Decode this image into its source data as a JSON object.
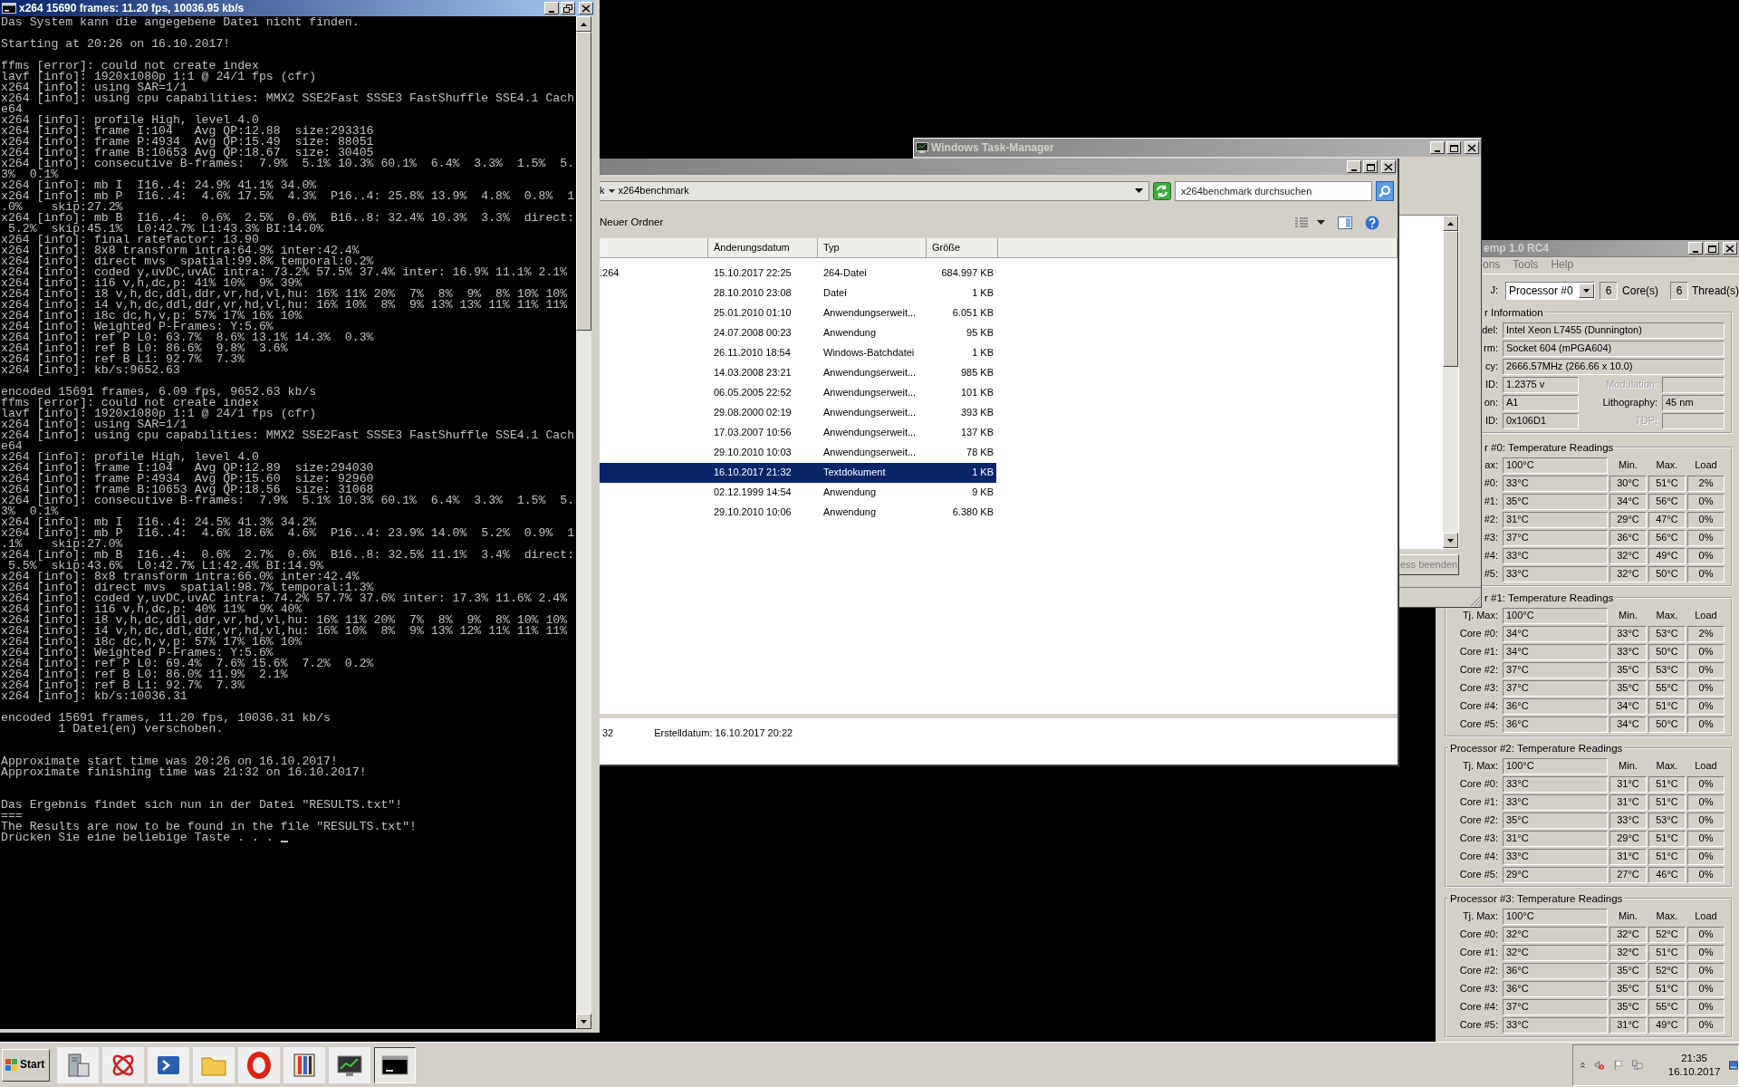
{
  "console": {
    "title": "x264 15690 frames: 11.20 fps, 10036.95 kb/s",
    "cursor_visible": true,
    "sections": [
      {
        "blocks": [
          [
            "Das System kann die angegebene Datei nicht finden."
          ],
          [
            "Starting at 20:26 on 16.10.2017!"
          ],
          [
            "ffms [error]: could not create index",
            "lavf [info]: 1920x1080p 1:1 @ 24/1 fps (cfr)",
            "x264 [info]: using SAR=1/1",
            "x264 [info]: using cpu capabilities: MMX2 SSE2Fast SSSE3 FastShuffle SSE4.1 Cach",
            "e64",
            "x264 [info]: profile High, level 4.0",
            "x264 [info]: frame I:104   Avg QP:12.88  size:293316",
            "x264 [info]: frame P:4934  Avg QP:15.49  size: 88051",
            "x264 [info]: frame B:10653 Avg QP:18.67  size: 30405",
            "x264 [info]: consecutive B-frames:  7.9%  5.1% 10.3% 60.1%  6.4%  3.3%  1.5%  5.",
            "3%  0.1%",
            "x264 [info]: mb I  I16..4: 24.9% 41.1% 34.0%",
            "x264 [info]: mb P  I16..4:  4.6% 17.5%  4.3%  P16..4: 25.8% 13.9%  4.8%  0.8%  1",
            ".0%    skip:27.2%",
            "x264 [info]: mb B  I16..4:  0.6%  2.5%  0.6%  B16..8: 32.4% 10.3%  3.3%  direct:",
            " 5.2%  skip:45.1%  L0:42.7% L1:43.3% BI:14.0%",
            "x264 [info]: final ratefactor: 13.90",
            "x264 [info]: 8x8 transform intra:64.9% inter:42.4%",
            "x264 [info]: direct mvs  spatial:99.8% temporal:0.2%",
            "x264 [info]: coded y,uvDC,uvAC intra: 73.2% 57.5% 37.4% inter: 16.9% 11.1% 2.1%",
            "x264 [info]: i16 v,h,dc,p: 41% 10%  9% 39%",
            "x264 [info]: i8 v,h,dc,ddl,ddr,vr,hd,vl,hu: 16% 11% 20%  7%  8%  9%  8% 10% 10%",
            "x264 [info]: i4 v,h,dc,ddl,ddr,vr,hd,vl,hu: 16% 10%  8%  9% 13% 13% 11% 11% 11%",
            "x264 [info]: i8c dc,h,v,p: 57% 17% 16% 10%",
            "x264 [info]: Weighted P-Frames: Y:5.6%",
            "x264 [info]: ref P L0: 63.7%  8.6% 13.1% 14.3%  0.3%",
            "x264 [info]: ref B L0: 86.6%  9.8%  3.6%",
            "x264 [info]: ref B L1: 92.7%  7.3%",
            "x264 [info]: kb/s:9652.63"
          ],
          [
            "encoded 15691 frames, 6.09 fps, 9652.63 kb/s",
            "ffms [error]: could not create index",
            "lavf [info]: 1920x1080p 1:1 @ 24/1 fps (cfr)",
            "x264 [info]: using SAR=1/1",
            "x264 [info]: using cpu capabilities: MMX2 SSE2Fast SSSE3 FastShuffle SSE4.1 Cach",
            "e64",
            "x264 [info]: profile High, level 4.0",
            "x264 [info]: frame I:104   Avg QP:12.89  size:294030",
            "x264 [info]: frame P:4934  Avg QP:15.60  size: 92960",
            "x264 [info]: frame B:10653 Avg QP:18.56  size: 31068",
            "x264 [info]: consecutive B-frames:  7.9%  5.1% 10.3% 60.1%  6.4%  3.3%  1.5%  5.",
            "3%  0.1%",
            "x264 [info]: mb I  I16..4: 24.5% 41.3% 34.2%",
            "x264 [info]: mb P  I16..4:  4.6% 18.6%  4.6%  P16..4: 23.9% 14.0%  5.2%  0.9%  1",
            ".1%    skip:27.0%",
            "x264 [info]: mb B  I16..4:  0.6%  2.7%  0.6%  B16..8: 32.5% 11.1%  3.4%  direct:",
            " 5.5%  skip:43.6%  L0:42.7% L1:42.4% BI:14.9%",
            "x264 [info]: 8x8 transform intra:66.0% inter:42.4%",
            "x264 [info]: direct mvs  spatial:98.7% temporal:1.3%",
            "x264 [info]: coded y,uvDC,uvAC intra: 74.2% 57.7% 37.6% inter: 17.3% 11.6% 2.4%",
            "x264 [info]: i16 v,h,dc,p: 40% 11%  9% 40%",
            "x264 [info]: i8 v,h,dc,ddl,ddr,vr,hd,vl,hu: 16% 11% 20%  7%  8%  9%  8% 10% 10%",
            "x264 [info]: i4 v,h,dc,ddl,ddr,vr,hd,vl,hu: 16% 10%  8%  9% 13% 12% 11% 11% 11%",
            "x264 [info]: i8c dc,h,v,p: 57% 17% 16% 10%",
            "x264 [info]: Weighted P-Frames: Y:5.6%",
            "x264 [info]: ref P L0: 69.4%  7.6% 15.6%  7.2%  0.2%",
            "x264 [info]: ref B L0: 86.0% 11.9%  2.1%",
            "x264 [info]: ref B L1: 92.7%  7.3%",
            "x264 [info]: kb/s:10036.31"
          ],
          [
            "encoded 15691 frames, 11.20 fps, 10036.31 kb/s",
            "        1 Datei(en) verschoben."
          ]
        ]
      },
      {
        "blocks": [
          [
            "Approximate start time was 20:26 on 16.10.2017!",
            "Approximate finishing time was 21:32 on 16.10.2017!"
          ]
        ]
      },
      {
        "blocks": [
          [
            "Das Ergebnis findet sich nun in der Datei \"RESULTS.txt\"!",
            "===",
            "The Results are now to be found in the file \"RESULTS.txt\"!",
            "Drücken Sie eine beliebige Taste . . ."
          ]
        ]
      }
    ]
  },
  "explorer": {
    "address": {
      "fragment": "k",
      "folder": "x264benchmark"
    },
    "search": {
      "placeholder": "x264benchmark durchsuchen"
    },
    "toolbar": [
      "Neuer Ordner"
    ],
    "columns": [
      "Änderungsdatum",
      "Typ",
      "Größe"
    ],
    "rows": [
      {
        "name": ".264",
        "date": "15.10.2017 22:25",
        "type": "264-Datei",
        "size": "684.997 KB",
        "selected": false
      },
      {
        "date": "28.10.2010 23:08",
        "type": "Datei",
        "size": "1 KB",
        "selected": false
      },
      {
        "date": "25.01.2010 01:10",
        "type": "Anwendungserweit...",
        "size": "6.051 KB",
        "selected": false
      },
      {
        "date": "24.07.2008 00:23",
        "type": "Anwendung",
        "size": "95 KB",
        "selected": false
      },
      {
        "date": "26.11.2010 18:54",
        "type": "Windows-Batchdatei",
        "size": "1 KB",
        "selected": false
      },
      {
        "date": "14.03.2008 23:21",
        "type": "Anwendungserweit...",
        "size": "985 KB",
        "selected": false
      },
      {
        "date": "06.05.2005 22:52",
        "type": "Anwendungserweit...",
        "size": "101 KB",
        "selected": false
      },
      {
        "date": "29.08.2000 02:19",
        "type": "Anwendungserweit...",
        "size": "393 KB",
        "selected": false
      },
      {
        "date": "17.03.2007 10:56",
        "type": "Anwendungserweit...",
        "size": "137 KB",
        "selected": false
      },
      {
        "date": "29.10.2010 10:03",
        "type": "Anwendungserweit...",
        "size": "78 KB",
        "selected": false
      },
      {
        "date": "16.10.2017 21:32",
        "type": "Textdokument",
        "size": "1 KB",
        "selected": true
      },
      {
        "date": "02.12.1999 14:54",
        "type": "Anwendung",
        "size": "9 KB",
        "selected": false
      },
      {
        "date": "29.10.2010 10:06",
        "type": "Anwendung",
        "size": "6.380 KB",
        "selected": false
      }
    ],
    "details": {
      "fragment": "32",
      "created": "Erstelldatum: 16.10.2017 20:22"
    }
  },
  "task_manager": {
    "title": "Windows Task-Manager",
    "button": "ess beenden"
  },
  "core_temp": {
    "title": "emp 1.0 RC4",
    "menu": [
      "ons",
      "Tools",
      "Help"
    ],
    "cpu_label": "J:",
    "processor_select": "Processor #0",
    "cores": "6",
    "cores_label": "Core(s)",
    "threads": "6",
    "threads_label": "Thread(s)",
    "info": {
      "legend": "r Information",
      "rows": [
        {
          "label": "del:",
          "value": "Intel Xeon L7455 (Dunnington)"
        },
        {
          "label": "rm:",
          "value": "Socket 604 (mPGA604)"
        },
        {
          "label": "cy:",
          "value": "2666.57MHz (266.66 x 10.0)"
        },
        {
          "label": "ID:",
          "value": "1.2375 v",
          "extra": {
            "label": "Modulation:",
            "disabled": true
          }
        },
        {
          "label": "on:",
          "value": "A1",
          "extra": {
            "label": "Lithography:",
            "value": "45 nm",
            "disabled": false
          }
        },
        {
          "label": "ID:",
          "value": "0x106D1",
          "extra": {
            "label": "TDP:",
            "disabled": true
          }
        }
      ]
    },
    "processors": [
      {
        "legend": "r #0: Temperature Readings",
        "tj_label": "ax:",
        "tj_max": "100°C",
        "headers": [
          "Min.",
          "Max.",
          "Load"
        ],
        "cores": [
          {
            "label": "#0:",
            "temp": "33°C",
            "min": "30°C",
            "max": "51°C",
            "load": "2%"
          },
          {
            "label": "#1:",
            "temp": "35°C",
            "min": "34°C",
            "max": "56°C",
            "load": "0%"
          },
          {
            "label": "#2:",
            "temp": "31°C",
            "min": "29°C",
            "max": "47°C",
            "load": "0%"
          },
          {
            "label": "#3:",
            "temp": "37°C",
            "min": "36°C",
            "max": "56°C",
            "load": "0%"
          },
          {
            "label": "#4:",
            "temp": "33°C",
            "min": "32°C",
            "max": "49°C",
            "load": "0%"
          },
          {
            "label": "#5:",
            "temp": "33°C",
            "min": "32°C",
            "max": "50°C",
            "load": "0%"
          }
        ]
      },
      {
        "legend": "r #1: Temperature Readings",
        "tj_label": "Tj. Max:",
        "tj_max": "100°C",
        "headers": [
          "Min.",
          "Max.",
          "Load"
        ],
        "cores": [
          {
            "label": "Core #0:",
            "temp": "34°C",
            "min": "33°C",
            "max": "53°C",
            "load": "2%"
          },
          {
            "label": "Core #1:",
            "temp": "34°C",
            "min": "33°C",
            "max": "50°C",
            "load": "0%"
          },
          {
            "label": "Core #2:",
            "temp": "37°C",
            "min": "35°C",
            "max": "53°C",
            "load": "0%"
          },
          {
            "label": "Core #3:",
            "temp": "37°C",
            "min": "35°C",
            "max": "55°C",
            "load": "0%"
          },
          {
            "label": "Core #4:",
            "temp": "36°C",
            "min": "34°C",
            "max": "51°C",
            "load": "0%"
          },
          {
            "label": "Core #5:",
            "temp": "36°C",
            "min": "34°C",
            "max": "50°C",
            "load": "0%"
          }
        ]
      },
      {
        "legend": "Processor #2: Temperature Readings",
        "tj_label": "Tj. Max:",
        "tj_max": "100°C",
        "headers": [
          "Min.",
          "Max.",
          "Load"
        ],
        "cores": [
          {
            "label": "Core #0:",
            "temp": "33°C",
            "min": "31°C",
            "max": "51°C",
            "load": "0%"
          },
          {
            "label": "Core #1:",
            "temp": "33°C",
            "min": "31°C",
            "max": "51°C",
            "load": "0%"
          },
          {
            "label": "Core #2:",
            "temp": "35°C",
            "min": "33°C",
            "max": "53°C",
            "load": "0%"
          },
          {
            "label": "Core #3:",
            "temp": "31°C",
            "min": "29°C",
            "max": "51°C",
            "load": "0%"
          },
          {
            "label": "Core #4:",
            "temp": "33°C",
            "min": "31°C",
            "max": "51°C",
            "load": "0%"
          },
          {
            "label": "Core #5:",
            "temp": "29°C",
            "min": "27°C",
            "max": "46°C",
            "load": "0%"
          }
        ]
      },
      {
        "legend": "Processor #3: Temperature Readings",
        "tj_label": "Tj. Max:",
        "tj_max": "100°C",
        "headers": [
          "Min.",
          "Max.",
          "Load"
        ],
        "cores": [
          {
            "label": "Core #0:",
            "temp": "32°C",
            "min": "32°C",
            "max": "52°C",
            "load": "0%"
          },
          {
            "label": "Core #1:",
            "temp": "32°C",
            "min": "32°C",
            "max": "51°C",
            "load": "0%"
          },
          {
            "label": "Core #2:",
            "temp": "36°C",
            "min": "35°C",
            "max": "52°C",
            "load": "0%"
          },
          {
            "label": "Core #3:",
            "temp": "36°C",
            "min": "35°C",
            "max": "51°C",
            "load": "0%"
          },
          {
            "label": "Core #4:",
            "temp": "37°C",
            "min": "35°C",
            "max": "55°C",
            "load": "0%"
          },
          {
            "label": "Core #5:",
            "temp": "33°C",
            "min": "31°C",
            "max": "49°C",
            "load": "0%"
          }
        ]
      }
    ]
  },
  "taskbar": {
    "start": "Start",
    "apps": [
      {
        "kind": "server",
        "selected": false
      },
      {
        "kind": "orbit",
        "selected": false
      },
      {
        "kind": "prompt",
        "selected": false
      },
      {
        "kind": "folder",
        "selected": false
      },
      {
        "kind": "ring",
        "selected": false
      },
      {
        "kind": "brushes",
        "selected": false
      },
      {
        "kind": "monitor",
        "selected": false
      },
      {
        "kind": "console",
        "selected": true
      }
    ],
    "clock": {
      "time": "21:35",
      "date": "16.10.2017"
    }
  }
}
